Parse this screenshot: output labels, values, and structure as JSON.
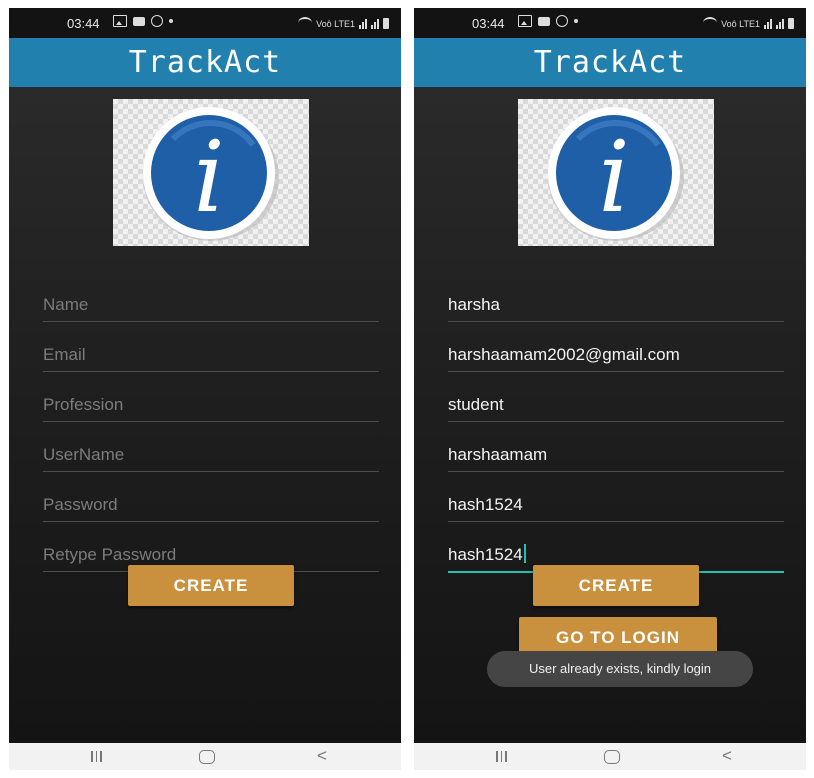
{
  "status_bar": {
    "time": "03:44",
    "network_label": "Voô LTE1"
  },
  "app": {
    "title": "TrackAct",
    "logo_letter": "i"
  },
  "left_screen": {
    "fields": [
      {
        "placeholder": "Name"
      },
      {
        "placeholder": "Email"
      },
      {
        "placeholder": "Profession"
      },
      {
        "placeholder": "UserName"
      },
      {
        "placeholder": "Password"
      },
      {
        "placeholder": "Retype Password"
      }
    ],
    "create_button": "CREATE"
  },
  "right_screen": {
    "fields": [
      {
        "value": "harsha"
      },
      {
        "value": "harshaamam2002@gmail.com"
      },
      {
        "value": "student"
      },
      {
        "value": "harshaamam"
      },
      {
        "value": "hash1524"
      },
      {
        "value": "hash1524"
      }
    ],
    "create_button": "CREATE",
    "login_button": "GO TO LOGIN",
    "toast": "User already exists, kindly login"
  },
  "colors": {
    "app_bar": "#2180ad",
    "button": "#c9913e",
    "focus_line": "#22c2b2",
    "logo_blue": "#1f5fa8"
  },
  "icons": [
    "gallery-icon",
    "message-icon",
    "sync-icon",
    "wifi-icon",
    "signal-icon",
    "battery-icon",
    "recent-apps-icon",
    "home-icon",
    "back-icon"
  ]
}
